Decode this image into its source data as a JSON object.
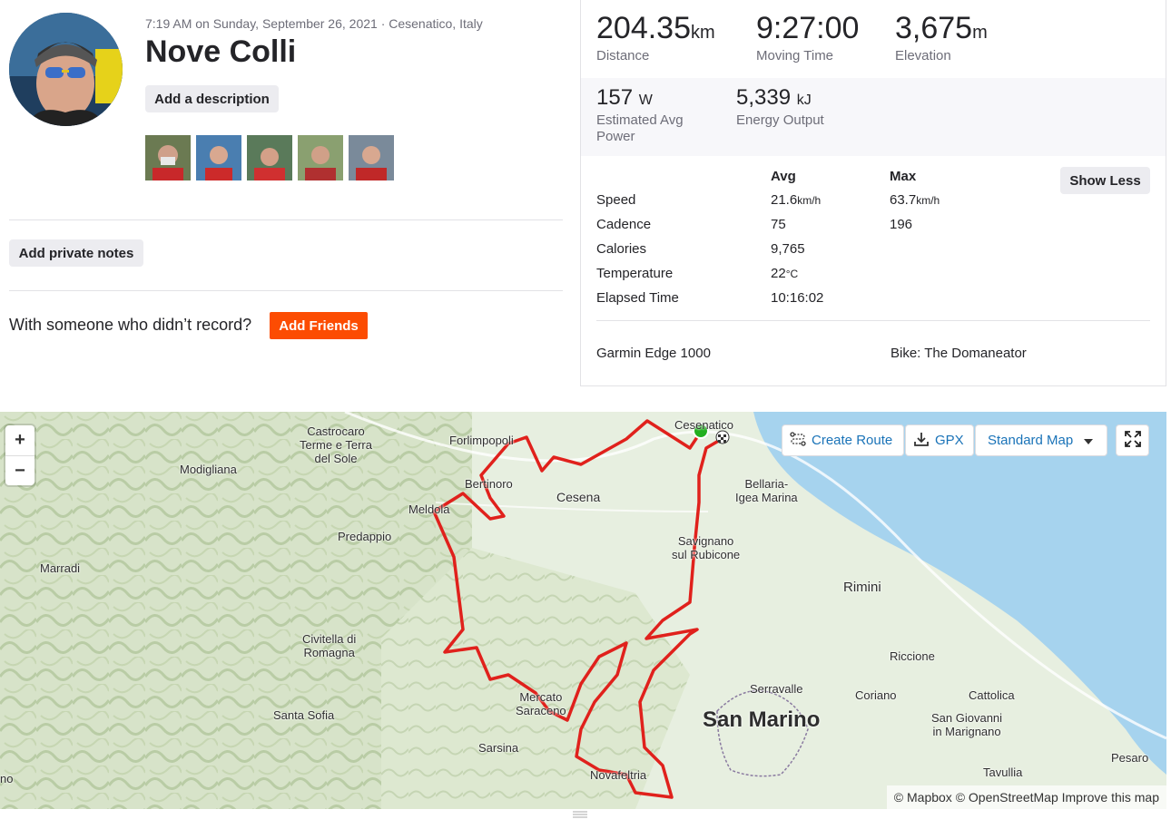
{
  "activity": {
    "meta": "7:19 AM on Sunday, September 26, 2021 · Cesenatico, Italy",
    "title": "Nove Colli",
    "add_description": "Add a description",
    "add_private_notes": "Add private notes",
    "with_someone": "With someone who didn’t record?",
    "add_friends": "Add Friends"
  },
  "stats": {
    "distance": {
      "value": "204.35",
      "unit": "km",
      "label": "Distance"
    },
    "moving_time": {
      "value": "9:27:00",
      "label": "Moving Time"
    },
    "elevation": {
      "value": "3,675",
      "unit": "m",
      "label": "Elevation"
    },
    "power": {
      "value": "157",
      "unit": "W",
      "label": "Estimated Avg Power"
    },
    "energy": {
      "value": "5,339",
      "unit": "kJ",
      "label": "Energy Output"
    }
  },
  "more_stats": {
    "col_avg": "Avg",
    "col_max": "Max",
    "show_less": "Show Less",
    "rows": [
      {
        "label": "Speed",
        "avg": "21.6",
        "avg_unit": "km/h",
        "max": "63.7",
        "max_unit": "km/h"
      },
      {
        "label": "Cadence",
        "avg": "75",
        "avg_unit": "",
        "max": "196",
        "max_unit": ""
      },
      {
        "label": "Calories",
        "avg": "9,765",
        "avg_unit": "",
        "max": "",
        "max_unit": ""
      },
      {
        "label": "Temperature",
        "avg": "22",
        "avg_unit": "°C",
        "max": "",
        "max_unit": ""
      },
      {
        "label": "Elapsed Time",
        "avg": "10:16:02",
        "avg_unit": "",
        "max": "",
        "max_unit": ""
      }
    ],
    "device": "Garmin Edge 1000",
    "bike": "Bike: The Domaneator"
  },
  "map": {
    "zoom_in": "+",
    "zoom_out": "−",
    "create_route": "Create Route",
    "gpx": "GPX",
    "map_style": "Standard Map",
    "attribution": "© Mapbox © OpenStreetMap Improve this map",
    "labels": {
      "castrocaro": "Castrocaro\nTerme e Terra\ndel Sole",
      "forlimpopoli": "Forlimpopoli",
      "cesenatico": "Cesenatico",
      "modigliana": "Modigliana",
      "bertinoro": "Bertinoro",
      "cesena": "Cesena",
      "bellaria": "Bellaria-\nIgea Marina",
      "meldola": "Meldola",
      "predappio": "Predappio",
      "savignano": "Savignano\nsul Rubicone",
      "marradi": "Marradi",
      "rimini": "Rimini",
      "civitella": "Civitella di\nRomagna",
      "riccione": "Riccione",
      "serravalle": "Serravalle",
      "mercato": "Mercato\nSaraceno",
      "coriano": "Coriano",
      "cattolica": "Cattolica",
      "santa_sofia": "Santa Sofia",
      "san_marino": "San Marino",
      "san_giovanni": "San Giovanni\nin Marignano",
      "sarsina": "Sarsina",
      "novafeltria": "Novafeltria",
      "tavullia": "Tavullia",
      "pesaro": "Pesaro",
      "no": "no"
    }
  }
}
